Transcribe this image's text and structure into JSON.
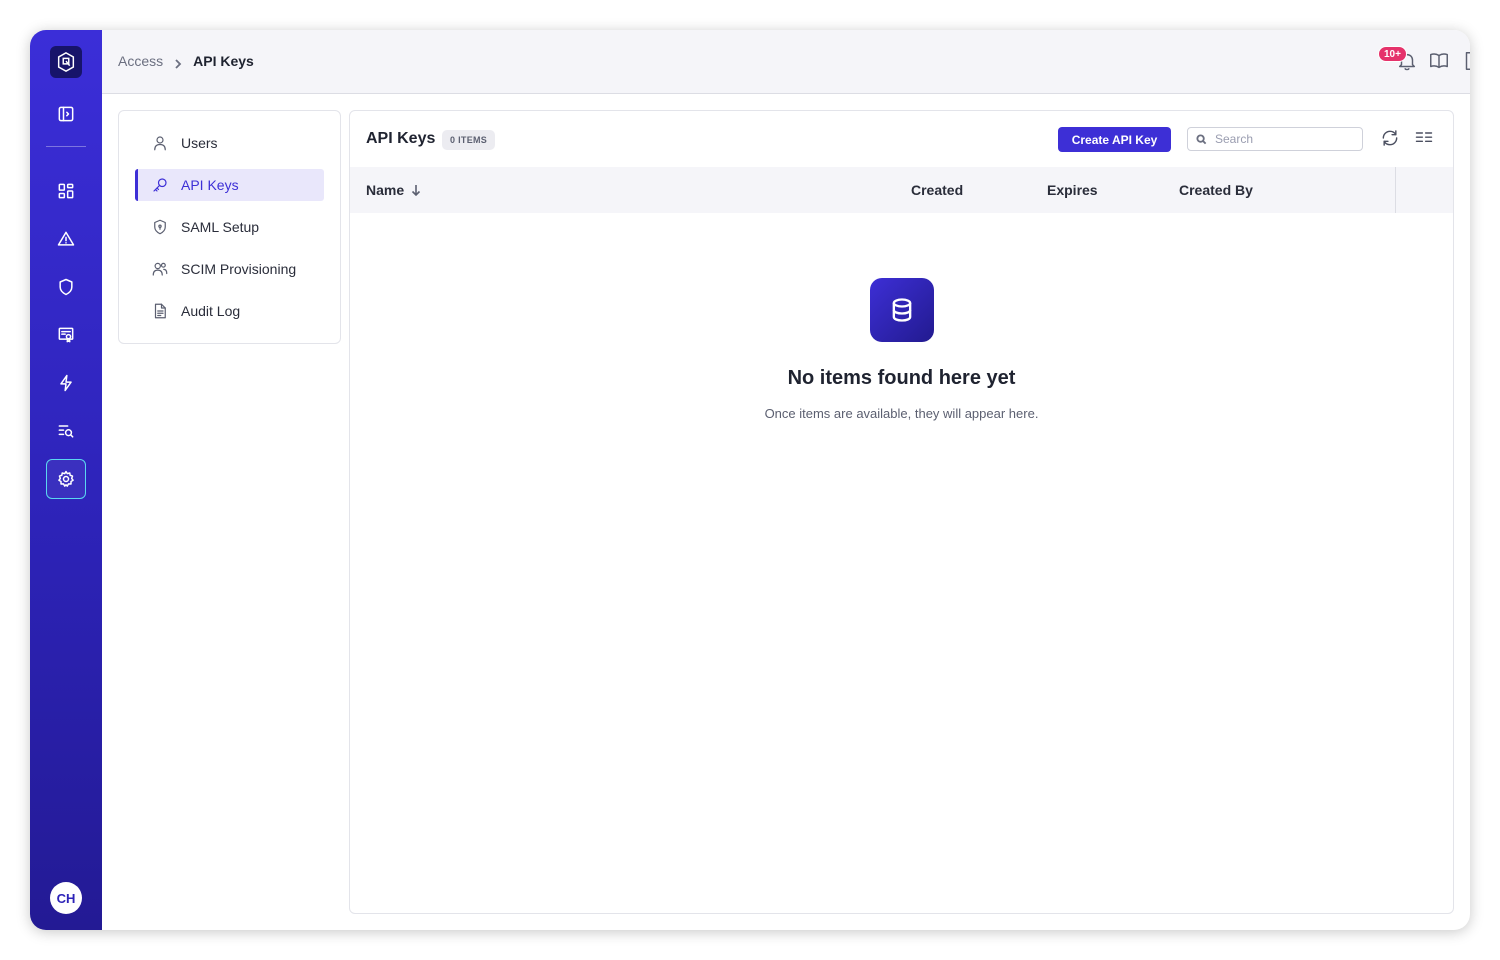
{
  "breadcrumb": {
    "parent": "Access",
    "current": "API Keys"
  },
  "topbar": {
    "notification_badge": "10+",
    "icons": [
      "bell-icon",
      "book-icon",
      "export-icon"
    ]
  },
  "rail": {
    "avatar_initials": "CH",
    "items": [
      "dashboard-icon",
      "alert-icon",
      "shield-icon",
      "certificate-icon",
      "bolt-icon",
      "search-list-icon",
      "settings-icon"
    ],
    "active": "settings-icon"
  },
  "menu": {
    "items": [
      {
        "label": "Users",
        "icon": "user-icon"
      },
      {
        "label": "API Keys",
        "icon": "key-icon",
        "active": true
      },
      {
        "label": "SAML Setup",
        "icon": "shield-icon"
      },
      {
        "label": "SCIM Provisioning",
        "icon": "users-icon"
      },
      {
        "label": "Audit Log",
        "icon": "document-icon"
      }
    ]
  },
  "panel": {
    "title": "API Keys",
    "count_label": "0 ITEMS",
    "create_label": "Create API Key",
    "search_placeholder": "Search",
    "columns": [
      "Name",
      "Created",
      "Expires",
      "Created By"
    ],
    "empty_title": "No items found here yet",
    "empty_subtitle": "Once items are available, they will appear here."
  },
  "colors": {
    "accent": "#3d2fd6",
    "badge": "#e5326b",
    "rail": "#2d23b8"
  }
}
